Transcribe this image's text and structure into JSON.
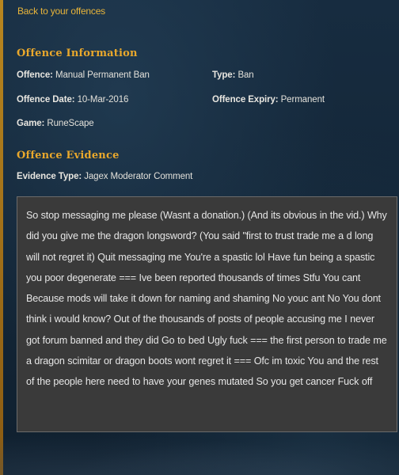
{
  "nav": {
    "back_label": "Back to your offences"
  },
  "offence_info": {
    "title": "Offence Information",
    "offence_key": "Offence:",
    "offence_value": "Manual Permanent Ban",
    "type_key": "Type:",
    "type_value": "Ban",
    "date_key": "Offence Date:",
    "date_value": "10-Mar-2016",
    "expiry_key": "Offence Expiry:",
    "expiry_value": "Permanent",
    "game_key": "Game:",
    "game_value": "RuneScape"
  },
  "evidence": {
    "title": "Offence Evidence",
    "type_key": "Evidence Type:",
    "type_value": "Jagex Moderator Comment",
    "text": "So stop messaging me please (Wasnt a donation.) (And its obvious in the vid.) Why did you give me the dragon longsword? (You said \"first to trust trade me a d long will not regret it) Quit messaging me You're a spastic lol Have fun being a spastic you poor degenerate === Ive been reported thousands of times Stfu You cant Because mods will take it down for naming and shaming No youc ant No You dont think i would know? Out of the thousands of posts of people accusing me I never got forum banned and they did Go to bed Ugly fuck === the first person to trade me a dragon scimitar or dragon boots wont regret it === Ofc im toxic You and the rest of the people here need to have your genes mutated So you get cancer Fuck off"
  },
  "colors": {
    "background": "#122536",
    "accent": "#e9a82c",
    "link": "#e9b53a",
    "evidence_box": "#3a3a3a"
  }
}
